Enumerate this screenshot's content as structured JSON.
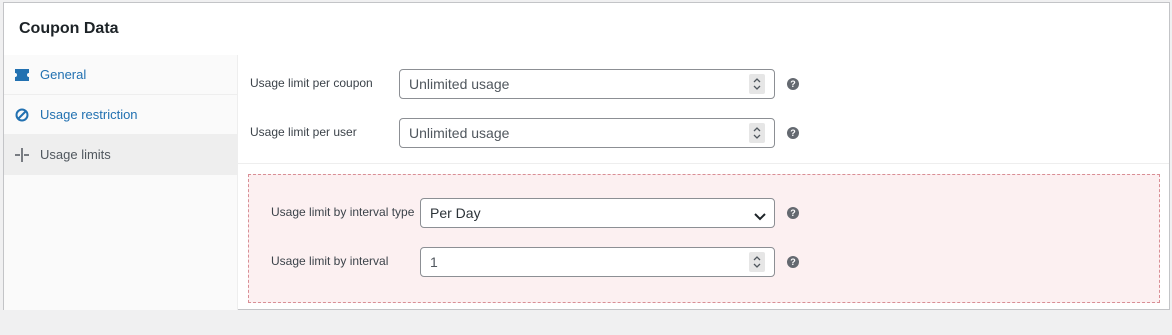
{
  "panel": {
    "title": "Coupon Data"
  },
  "tabs": [
    {
      "label": "General",
      "icon": "ticket-icon",
      "active": false
    },
    {
      "label": "Usage restriction",
      "icon": "ban-icon",
      "active": false
    },
    {
      "label": "Usage limits",
      "icon": "limits-icon",
      "active": true
    }
  ],
  "usage_limits": {
    "per_coupon": {
      "label": "Usage limit per coupon",
      "placeholder": "Unlimited usage",
      "value": ""
    },
    "per_user": {
      "label": "Usage limit per user",
      "placeholder": "Unlimited usage",
      "value": ""
    }
  },
  "interval": {
    "type": {
      "label": "Usage limit by interval type",
      "selected": "Per Day"
    },
    "limit": {
      "label": "Usage limit by interval",
      "value": "1"
    }
  },
  "help_glyph": "?",
  "colors": {
    "link": "#2271b1",
    "restriction_bg": "#fcf0f1",
    "restriction_border": "#d98e95"
  }
}
